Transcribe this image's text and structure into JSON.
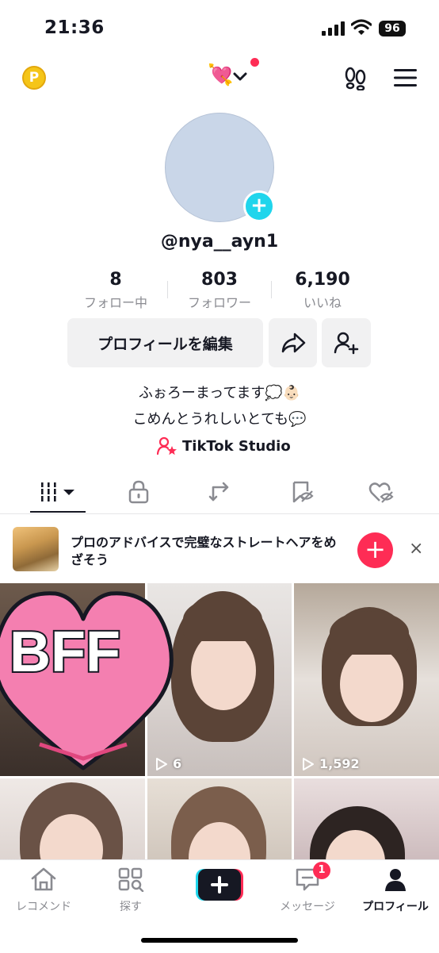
{
  "status": {
    "time": "21:36",
    "battery": "96"
  },
  "header": {
    "coin_label": "P",
    "account_emoji": "💘",
    "notification_dot": true
  },
  "profile": {
    "handle": "@nya__ayn1",
    "stats": [
      {
        "num": "8",
        "label": "フォロー中"
      },
      {
        "num": "803",
        "label": "フォロワー"
      },
      {
        "num": "6,190",
        "label": "いいね"
      }
    ],
    "edit_label": "プロフィールを編集",
    "bio_line1": "ふぉろーまってます💭👶🏻",
    "bio_line2": "こめんとうれしいとても💬",
    "studio_label": "TikTok Studio"
  },
  "ad": {
    "text": "プロのアドバイスで完璧なストレートヘアをめざそう",
    "plus": "+",
    "close": "×"
  },
  "grid": [
    {
      "overlay": "BFF",
      "views": ""
    },
    {
      "views": "6"
    },
    {
      "views": "1,592"
    },
    {
      "views": ""
    },
    {
      "views": ""
    },
    {
      "views": ""
    }
  ],
  "nav": [
    {
      "label": "レコメンド",
      "icon": "home-icon"
    },
    {
      "label": "探す",
      "icon": "search-grid-icon"
    },
    {
      "label": "",
      "icon": "create-plus-icon"
    },
    {
      "label": "メッセージ",
      "icon": "message-icon",
      "badge": "1"
    },
    {
      "label": "プロフィール",
      "icon": "person-icon",
      "active": true
    }
  ],
  "colors": {
    "accent": "#fe2c55",
    "cyan": "#20d5ec",
    "muted": "#8a8b91"
  }
}
